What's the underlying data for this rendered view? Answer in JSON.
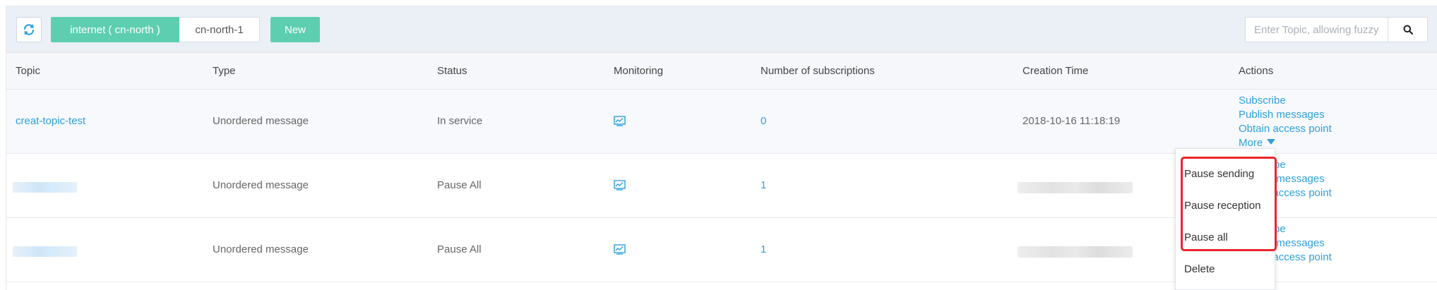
{
  "toolbar": {
    "refresh_icon": "refresh-icon",
    "region_tabs": [
      "internet ( cn-north )",
      "cn-north-1"
    ],
    "new_label": "New",
    "search_placeholder": "Enter Topic, allowing fuzzy search",
    "search_icon": "search-icon"
  },
  "table": {
    "headers": [
      "Topic",
      "Type",
      "Status",
      "Monitoring",
      "Number of subscriptions",
      "Creation Time",
      "Actions"
    ],
    "rows": [
      {
        "topic": "creat-topic-test",
        "type": "Unordered message",
        "status": "In service",
        "monitoring_icon": "monitor-chart-icon",
        "subscriptions": "0",
        "creation_time": "2018-10-16 11:18:19",
        "actions": [
          "Subscribe",
          "Publish messages",
          "Obtain access point",
          "More"
        ]
      },
      {
        "topic": "",
        "type": "Unordered message",
        "status": "Pause All",
        "monitoring_icon": "monitor-chart-icon",
        "subscriptions": "1",
        "creation_time": "",
        "actions": [
          "Subscribe",
          "Publish messages",
          "Obtain access point"
        ]
      },
      {
        "topic": "",
        "type": "Unordered message",
        "status": "Pause All",
        "monitoring_icon": "monitor-chart-icon",
        "subscriptions": "1",
        "creation_time": "",
        "actions": [
          "Subscribe",
          "Publish messages",
          "Obtain access point"
        ]
      }
    ]
  },
  "more_menu": {
    "items": [
      "Pause sending",
      "Pause reception",
      "Pause all",
      "Delete"
    ]
  },
  "colors": {
    "accent": "#5dcfb0",
    "link": "#2ea0dd",
    "highlight_box": "#e8262a",
    "toolbar_bg": "#ebf0f6"
  }
}
